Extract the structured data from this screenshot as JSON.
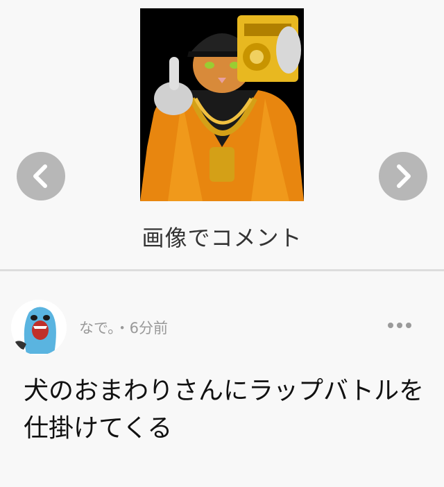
{
  "carousel": {
    "image_alt": "cat rapper with gold chains and boombox",
    "prev_icon": "chevron-left-icon",
    "next_icon": "chevron-right-icon",
    "label": "画像でコメント"
  },
  "comment": {
    "username": "なで。",
    "time": "・6分前",
    "more_icon": "more-dots-icon",
    "text": "犬のおまわりさんにラップバトルを仕掛けてくる",
    "avatar_icon": "avatar-blue-creature-icon"
  },
  "colors": {
    "background": "#f8f8f8",
    "nav_button": "#b7b7b7",
    "divider": "#dddddd",
    "meta_text": "#999999",
    "body_text": "#111111"
  }
}
